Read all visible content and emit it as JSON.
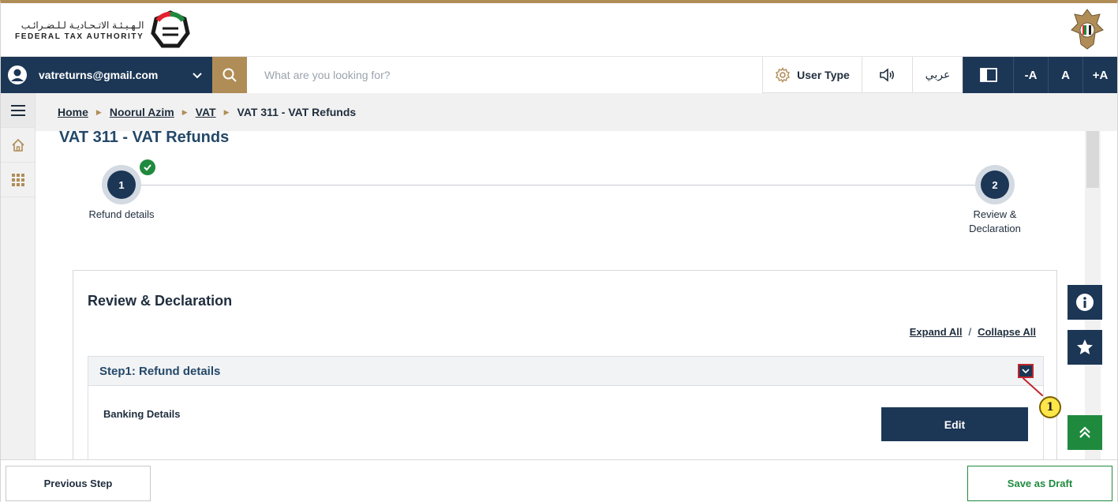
{
  "header": {
    "logo_arabic": "الـهـيـئـة الاتـحـاديـة لـلـضـرائـب",
    "logo_english": "FEDERAL TAX AUTHORITY",
    "logo_icon": "fta-logo-mark",
    "emblem_icon": "uae-emblem"
  },
  "topbar": {
    "user_email": "vatreturns@gmail.com",
    "search_placeholder": "What are you looking for?",
    "user_type_label": "User Type",
    "arabic_label": "عربي",
    "font_decrease": "-A",
    "font_normal": "A",
    "font_increase": "+A"
  },
  "breadcrumb": {
    "items": [
      "Home",
      "Noorul Azim",
      "VAT"
    ],
    "current": "VAT 311 - VAT Refunds"
  },
  "page": {
    "title": "VAT 311 - VAT Refunds"
  },
  "stepper": {
    "steps": [
      {
        "number": "1",
        "label": "Refund details",
        "completed": true
      },
      {
        "number": "2",
        "label_line1": "Review &",
        "label_line2": "Declaration",
        "completed": false
      }
    ]
  },
  "review": {
    "title": "Review & Declaration",
    "expand_all": "Expand All",
    "separator": "/",
    "collapse_all": "Collapse All",
    "accordion_title": "Step1: Refund details",
    "banking_label": "Banking Details",
    "edit_label": "Edit"
  },
  "annotation": {
    "number": "1"
  },
  "footer": {
    "previous_label": "Previous Step",
    "draft_label": "Save as Draft"
  },
  "colors": {
    "navy": "#1c3655",
    "gold": "#b08d57",
    "green": "#1f8a3e",
    "title_blue": "#244868",
    "annotation_red": "#c0272d",
    "annotation_yellow": "#ffe74a"
  }
}
